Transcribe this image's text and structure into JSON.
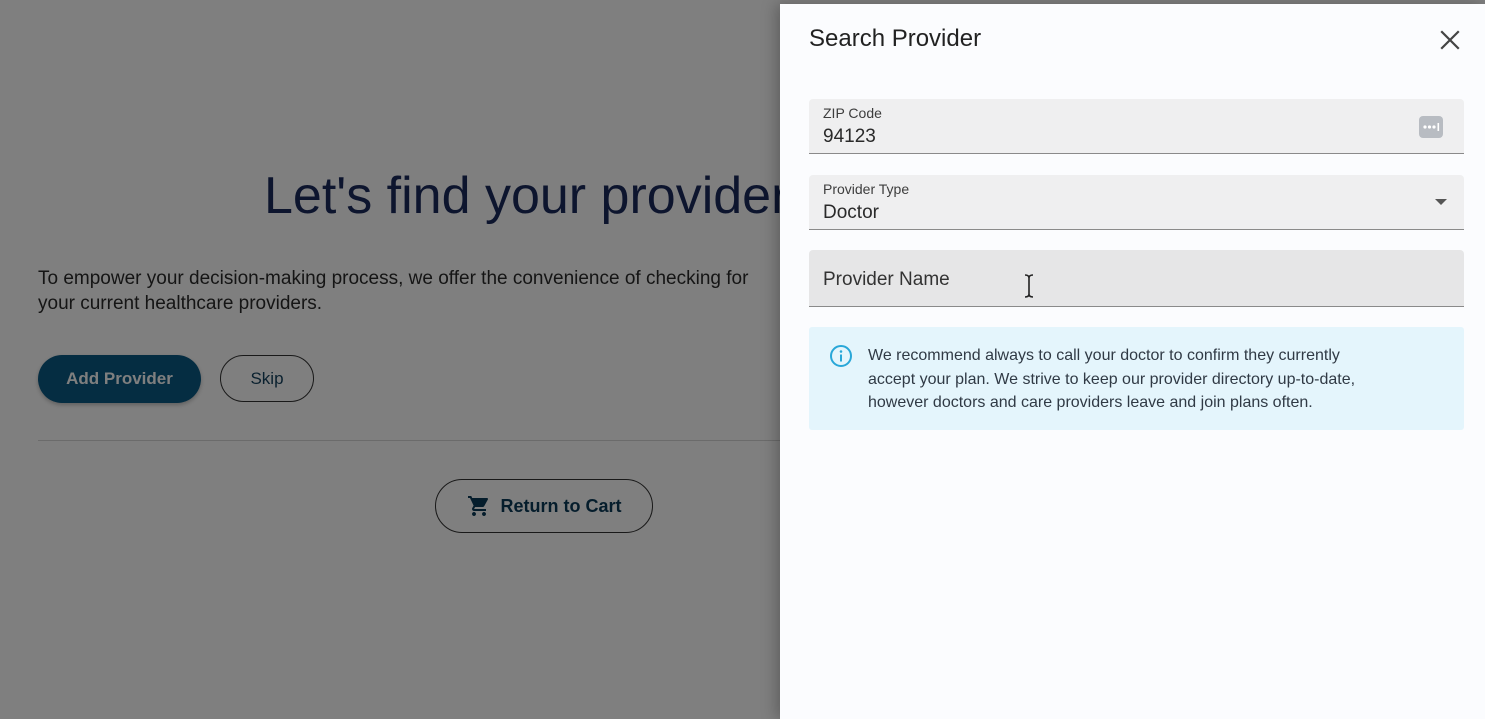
{
  "page": {
    "title": "Let's find your providers",
    "description_lines": [
      "To empower your decision-making process, we offer the convenience of checking for",
      "your current healthcare providers."
    ],
    "add_provider_label": "Add Provider",
    "skip_label": "Skip",
    "return_to_cart_label": "Return to Cart",
    "icons": {
      "cart": "shopping-cart-icon"
    }
  },
  "drawer": {
    "title": "Search Provider",
    "close_icon": "close-icon",
    "zip": {
      "label": "ZIP Code",
      "value": "94123",
      "icon": "autofill-ellipsis-icon"
    },
    "provider_type": {
      "label": "Provider Type",
      "value": "Doctor",
      "icon": "dropdown-caret-icon"
    },
    "provider_name": {
      "placeholder": "Provider Name",
      "value": ""
    },
    "info": {
      "icon": "info-icon",
      "lines": [
        "We recommend always to call your doctor to confirm they currently",
        "accept your plan. We strive to keep our provider directory up-to-date,",
        "however doctors and care providers leave and join plans often."
      ]
    }
  },
  "colors": {
    "primary": "#0b5a84",
    "title_navy": "#1b2a5c",
    "info_bg": "#e4f5fc",
    "info_icon": "#29a7d8",
    "overlay": "rgba(0,0,0,0.5)"
  }
}
